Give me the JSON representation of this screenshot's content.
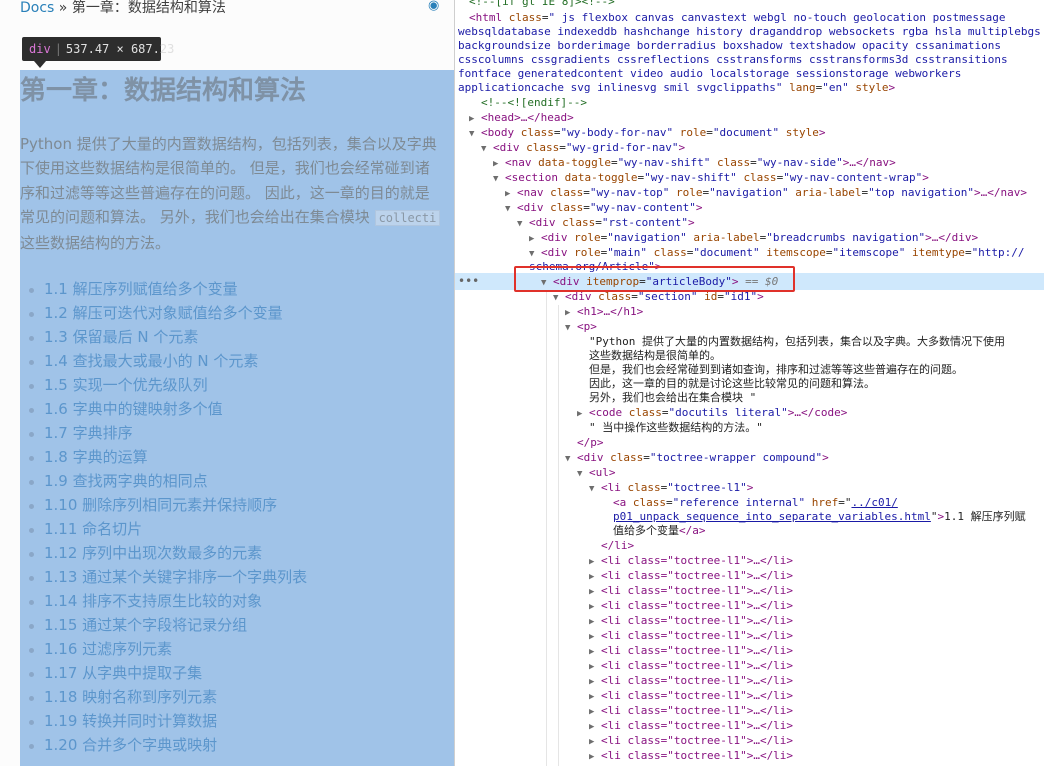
{
  "page": {
    "breadcrumb": {
      "root": "Docs",
      "separator": "»",
      "current": "第一章：数据结构和算法"
    },
    "github_icon": "github-icon",
    "inspect_tooltip": {
      "tag": "div",
      "size": "537.47 × 687.23"
    },
    "heading": "第一章：数据结构和算法",
    "intro_lines": [
      "Python 提供了大量的内置数据结构，包括列表，集合以及字典",
      "下使用这些数据结构是很简单的。 但是，我们也会经常碰到诸",
      "序和过滤等等这些普遍存在的问题。 因此，这一章的目的就是",
      "常见的问题和算法。 另外，我们也会给出在集合模块",
      "这些数据结构的方法。"
    ],
    "intro_code": "collecti",
    "toc": [
      "1.1 解压序列赋值给多个变量",
      "1.2 解压可迭代对象赋值给多个变量",
      "1.3 保留最后 N 个元素",
      "1.4 查找最大或最小的 N 个元素",
      "1.5 实现一个优先级队列",
      "1.6 字典中的键映射多个值",
      "1.7 字典排序",
      "1.8 字典的运算",
      "1.9 查找两字典的相同点",
      "1.10 删除序列相同元素并保持顺序",
      "1.11 命名切片",
      "1.12 序列中出现次数最多的元素",
      "1.13 通过某个关键字排序一个字典列表",
      "1.14 排序不支持原生比较的对象",
      "1.15 通过某个字段将记录分组",
      "1.16 过滤序列元素",
      "1.17 从字典中提取子集",
      "1.18 映射名称到序列元素",
      "1.19 转换并同时计算数据",
      "1.20 合并多个字典或映射"
    ]
  },
  "devtools": {
    "comment_top": "<!--[if gt IE 8]><!-->",
    "html_tag": "html",
    "html_class_attr": "class",
    "html_classes": [
      "\" js flexbox canvas canvastext webgl no-touch geolocation postmessage",
      "websqldatabase indexeddb hashchange history draganddrop websockets rgba hsla multiplebgs",
      "backgroundsize borderimage borderradius boxshadow textshadow opacity cssanimations",
      "csscolumns cssgradients cssreflections csstransforms csstransforms3d csstransitions",
      "fontface generatedcontent video audio localstorage sessionstorage webworkers",
      "applicationcache svg inlinesvg smil svgclippaths\""
    ],
    "html_lang": "\"en\"",
    "comment_endif": "<!--<![endif]-->",
    "head": "<head>…</head>",
    "body_line": {
      "tag": "body",
      "class": "\"wy-body-for-nav\"",
      "role": "\"document\"",
      "extra": "style"
    },
    "grid_line": {
      "tag": "div",
      "class": "\"wy-grid-for-nav\""
    },
    "nav_side": {
      "tag": "nav",
      "toggle": "\"wy-nav-shift\"",
      "class": "\"wy-nav-side\"",
      "tail": "…</nav>"
    },
    "section_line": {
      "tag": "section",
      "toggle": "\"wy-nav-shift\"",
      "class": "\"wy-nav-content-wrap\""
    },
    "nav_top": {
      "tag": "nav",
      "class": "\"wy-nav-top\"",
      "role": "\"navigation\"",
      "aria": "\"top navigation\"",
      "tail": "…</nav>"
    },
    "content_line": {
      "tag": "div",
      "class": "\"wy-nav-content\""
    },
    "rst_line": {
      "tag": "div",
      "class": "\"rst-content\""
    },
    "crumbs_line": {
      "tag": "div",
      "role": "\"navigation\"",
      "aria": "\"breadcrumbs navigation\"",
      "tail": "…</div>"
    },
    "main_line": {
      "tag": "div",
      "role": "\"main\"",
      "class": "\"document\"",
      "scope": "\"itemscope\"",
      "type1": "\"http://",
      "type2": "schema.org/Article\""
    },
    "selected": {
      "tag": "div",
      "attr": "itemprop",
      "value": "\"articleBody\"",
      "marker": "== $0"
    },
    "section_id": {
      "tag": "div",
      "class": "\"section\"",
      "id": "\"id1\""
    },
    "h1": "<h1>…</h1>",
    "p_open": "<p>",
    "p_text": [
      "\"Python 提供了大量的内置数据结构，包括列表，集合以及字典。大多数情况下使用",
      "这些数据结构是很简单的。",
      "但是，我们也会经常碰到到诸如查询，排序和过滤等等这些普遍存在的问题。",
      "因此，这一章的目的就是讨论这些比较常见的问题和算法。",
      "另外，我们也会给出在集合模块 \""
    ],
    "code_line": {
      "tag": "code",
      "class": "\"docutils literal\"",
      "tail": "…</code>"
    },
    "p_text_end": "\" 当中操作这些数据结构的方法。\"",
    "p_close": "</p>",
    "toctree": {
      "tag": "div",
      "class": "\"toctree-wrapper compound\""
    },
    "ul": "<ul>",
    "li_open": {
      "tag": "li",
      "class": "\"toctree-l1\""
    },
    "a_line": {
      "class": "\"reference internal\"",
      "href1": "../c01/",
      "href2": "p01_unpack_sequence_into_separate_variables.html",
      "text1": "1.1 解压序列赋",
      "text2": "值给多个变量"
    },
    "li_close": "</li>",
    "li_collapsed": "<li class=\"toctree-l1\">…</li>"
  }
}
